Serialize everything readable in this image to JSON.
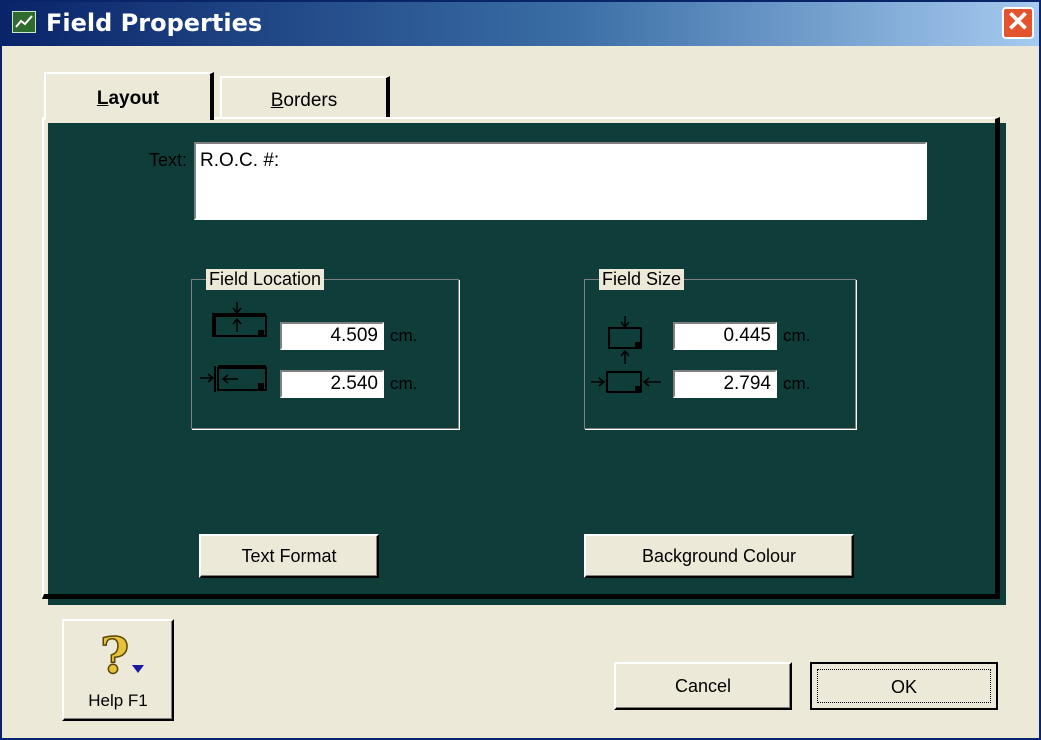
{
  "window": {
    "title": "Field Properties",
    "close_label": "✕"
  },
  "tabs": [
    {
      "label": "Layout",
      "accesskey": "L",
      "active": true
    },
    {
      "label": "Borders",
      "accesskey": "B",
      "active": false
    }
  ],
  "text_field": {
    "label": "Text:",
    "value": "R.O.C. #:"
  },
  "field_location": {
    "legend": "Field Location",
    "top_value": "4.509",
    "left_value": "2.540",
    "unit": "cm."
  },
  "field_size": {
    "legend": "Field Size",
    "height_value": "0.445",
    "width_value": "2.794",
    "unit": "cm."
  },
  "buttons": {
    "text_format": "Text Format",
    "background_colour": "Background Colour",
    "help": "Help F1",
    "cancel": "Cancel",
    "ok": "OK"
  },
  "colors": {
    "title_start": "#0a246a",
    "title_end": "#a6caf0",
    "close": "#e3532d",
    "help_icon": "#e6c13a"
  }
}
